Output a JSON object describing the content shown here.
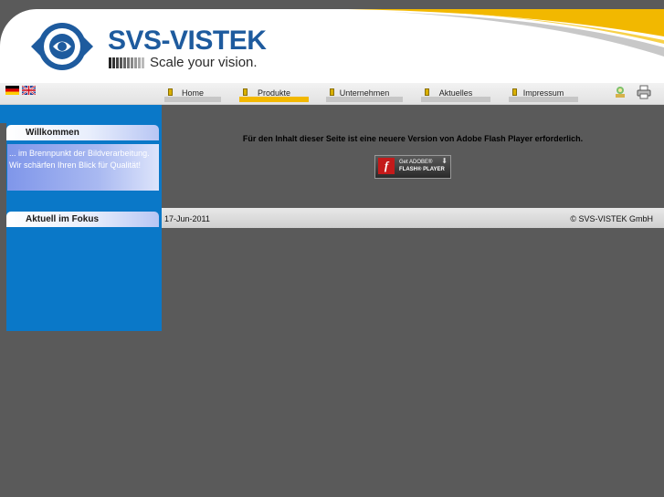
{
  "header": {
    "logo_text": "SVS-VISTEK",
    "tagline": "Scale your vision."
  },
  "languages": [
    "Deutsch",
    "English"
  ],
  "nav": {
    "items": [
      {
        "label": "Home"
      },
      {
        "label": "Produkte"
      },
      {
        "label": "Unternehmen"
      },
      {
        "label": "Aktuelles"
      },
      {
        "label": "Impressum"
      }
    ],
    "active": "Produkte"
  },
  "tools": [
    "sitemap-icon",
    "print-icon"
  ],
  "sidebar": {
    "welcome": {
      "title": "Willkommen",
      "line1": "... im Brennpunkt der Bildverarbeitung.",
      "line2": "Wir schärfen Ihren Blick für Qualität!"
    },
    "focus": {
      "title": "Aktuell im Fokus"
    }
  },
  "content": {
    "flash_message": "Für den Inhalt dieser Seite ist eine neuere Version von Adobe Flash Player erforderlich.",
    "flash_button": {
      "line1": "Get ADOBE®",
      "line2": "FLASH® PLAYER"
    }
  },
  "footer": {
    "date": "17-Jun-2011",
    "copyright": "© SVS-VISTEK GmbH"
  },
  "colors": {
    "brand_blue": "#1e5b9e",
    "sidebar_blue": "#0a78c8",
    "accent_yellow": "#f2b800",
    "background_gray": "#5a5a5a"
  }
}
